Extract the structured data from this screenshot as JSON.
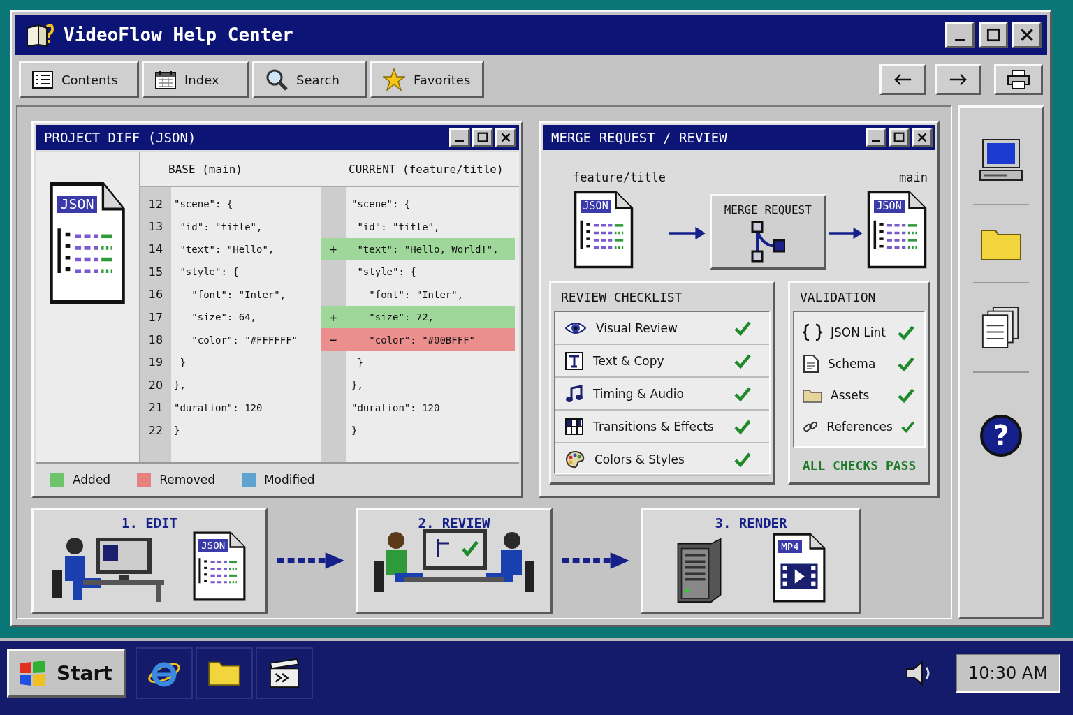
{
  "window": {
    "title": "VideoFlow Help Center"
  },
  "toolbar": {
    "tabs": [
      {
        "label": "Contents"
      },
      {
        "label": "Index"
      },
      {
        "label": "Search"
      },
      {
        "label": "Favorites"
      }
    ]
  },
  "diff": {
    "title": "PROJECT DIFF (JSON)",
    "file_badge": "JSON",
    "base_header": "BASE (main)",
    "current_header": "CURRENT (feature/title)",
    "rows": [
      {
        "line": "12",
        "base": "\"scene\": {",
        "current": "\"scene\": {",
        "added": false,
        "removed": false
      },
      {
        "line": "13",
        "base": " \"id\": \"title\",",
        "current": " \"id\": \"title\",",
        "added": false,
        "removed": false
      },
      {
        "line": "14",
        "base": " \"text\": \"Hello\",",
        "current": " \"text\": \"Hello, World!\",",
        "added": true,
        "removed": false,
        "marker": "+"
      },
      {
        "line": "15",
        "base": " \"style\": {",
        "current": " \"style\": {",
        "added": false,
        "removed": false
      },
      {
        "line": "16",
        "base": "   \"font\": \"Inter\",",
        "current": "   \"font\": \"Inter\",",
        "added": false,
        "removed": false
      },
      {
        "line": "17",
        "base": "   \"size\": 64,",
        "current": "   \"size\": 72,",
        "added": true,
        "removed": false,
        "marker": "+"
      },
      {
        "line": "18",
        "base": "   \"color\": \"#FFFFFF\"",
        "current": "   \"color\": \"#00BFFF\"",
        "added": false,
        "removed": true,
        "marker": "−"
      },
      {
        "line": "19",
        "base": " }",
        "current": " }",
        "added": false,
        "removed": false
      },
      {
        "line": "20",
        "base": "},",
        "current": "},",
        "added": false,
        "removed": false
      },
      {
        "line": "21",
        "base": "\"duration\": 120",
        "current": "\"duration\": 120",
        "added": false,
        "removed": false
      },
      {
        "line": "22",
        "base": "}",
        "current": "}",
        "added": false,
        "removed": false
      }
    ],
    "legend": [
      {
        "label": "Added",
        "color": "#6cc46c"
      },
      {
        "label": "Removed",
        "color": "#e88080"
      },
      {
        "label": "Modified",
        "color": "#5fa3d0"
      }
    ]
  },
  "merge": {
    "title": "MERGE REQUEST / REVIEW",
    "source_branch": "feature/title",
    "target_branch": "main",
    "source_badge": "JSON",
    "target_badge": "JSON",
    "merge_label": "MERGE REQUEST",
    "checklist": {
      "title": "REVIEW CHECKLIST",
      "items": [
        {
          "label": "Visual Review",
          "checked": true
        },
        {
          "label": "Text & Copy",
          "checked": true
        },
        {
          "label": "Timing & Audio",
          "checked": true
        },
        {
          "label": "Transitions & Effects",
          "checked": true
        },
        {
          "label": "Colors & Styles",
          "checked": true
        }
      ]
    },
    "validation": {
      "title": "VALIDATION",
      "items": [
        {
          "label": "JSON Lint",
          "checked": true
        },
        {
          "label": "Schema",
          "checked": true
        },
        {
          "label": "Assets",
          "checked": true
        },
        {
          "label": "References",
          "checked": true
        }
      ],
      "status": "ALL CHECKS PASS"
    }
  },
  "workflow": [
    {
      "kind": "edit",
      "label": "1. EDIT",
      "badge": "JSON"
    },
    {
      "kind": "review",
      "label": "2. REVIEW"
    },
    {
      "kind": "render",
      "label": "3. RENDER",
      "badge": "MP4"
    }
  ],
  "sidebar": {
    "help": "?"
  },
  "taskbar": {
    "start": "Start",
    "clock": "10:30 AM"
  }
}
